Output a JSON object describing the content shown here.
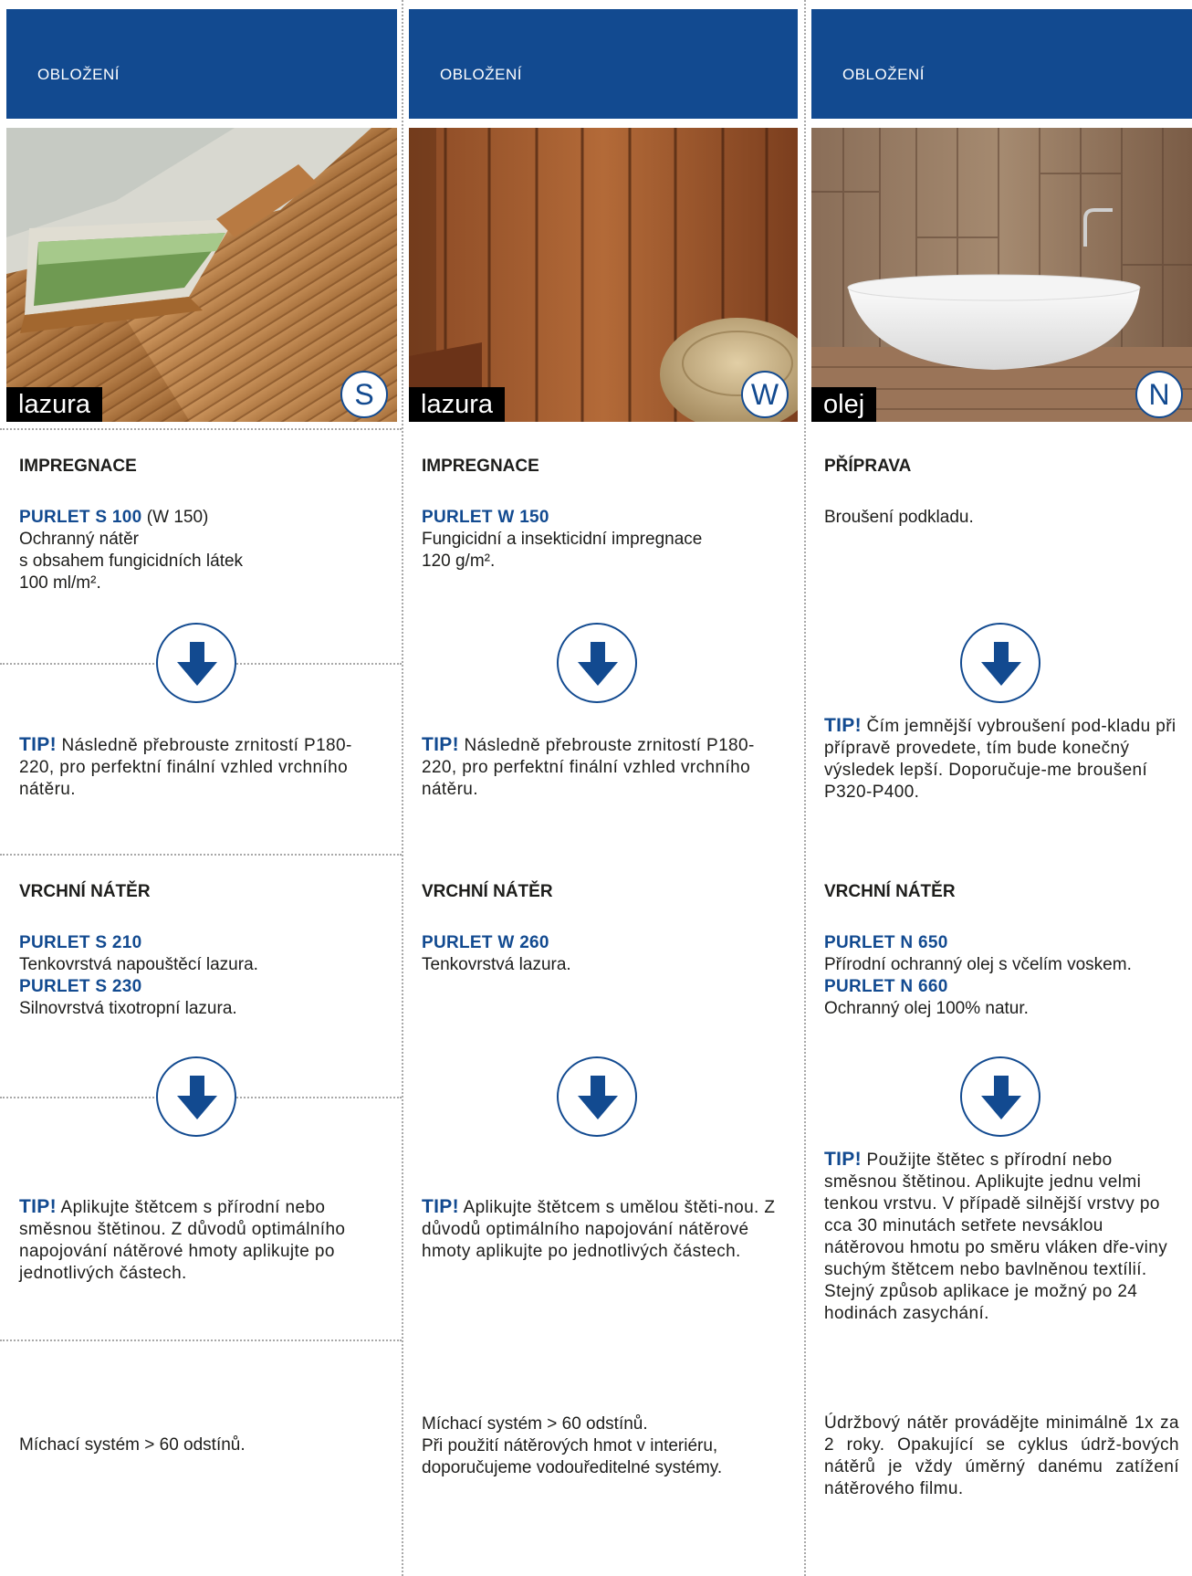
{
  "colors": {
    "brand_blue": "#124a90",
    "label_black": "#000000",
    "dotted_rule": "#a8a8a8"
  },
  "columns": [
    {
      "header": "OBLOŽENÍ",
      "photo_subject": "attic-skylight-wood-paneling",
      "finish": "lazura",
      "system": "S",
      "stage1": {
        "title": "IMPREGNACE",
        "product": "PURLET S 100",
        "product_suffix": " (W 150)",
        "lines": [
          "Ochranný nátěr",
          "s obsahem fungicidních látek",
          "100 ml/m²."
        ]
      },
      "tip1": {
        "label": "TIP!",
        "text": " Následně přebrouste zrnitostí P180-220, pro perfektní finální vzhled vrchního nátěru."
      },
      "stage2": {
        "title": "VRCHNÍ NÁTĚR",
        "product_a": "PURLET S 210",
        "desc_a": "Tenkovrstvá napouštěcí lazura.",
        "product_b": "PURLET S 230",
        "desc_b": "Silnovrstvá tixotropní lazura."
      },
      "tip2": {
        "label": "TIP!",
        "text": " Aplikujte štětcem s přírodní nebo směsnou štětinou. Z důvodů optimálního napojování nátěrové hmoty aplikujte po jednotlivých částech."
      },
      "footer": [
        "Míchací systém > 60 odstínů."
      ]
    },
    {
      "header": "OBLOŽENÍ",
      "photo_subject": "wood-wall-panels",
      "finish": "lazura",
      "system": "W",
      "stage1": {
        "title": "IMPREGNACE",
        "product": "PURLET W 150",
        "product_suffix": "",
        "lines": [
          "Fungicidní a insekticidní impregnace",
          "120 g/m²."
        ]
      },
      "tip1": {
        "label": "TIP!",
        "text": " Následně přebrouste zrnitostí P180-220, pro perfektní finální vzhled vrchního nátěru."
      },
      "stage2": {
        "title": "VRCHNÍ NÁTĚR",
        "product_a": "PURLET W 260",
        "desc_a": "Tenkovrstvá lazura.",
        "product_b": "",
        "desc_b": ""
      },
      "tip2": {
        "label": "TIP!",
        "text": " Aplikujte štětcem s umělou štěti-nou. Z důvodů optimálního napojování nátěrové hmoty aplikujte po jednotlivých částech."
      },
      "footer": [
        "Míchací systém > 60 odstínů.",
        "Při použití nátěrových hmot v interiéru, doporučujeme vodouředitelné systémy."
      ]
    },
    {
      "header": "OBLOŽENÍ",
      "photo_subject": "bathtub-wood-wall",
      "finish": "olej",
      "system": "N",
      "stage1": {
        "title": "PŘÍPRAVA",
        "product": "",
        "product_suffix": "",
        "lines": [
          "Broušení podkladu."
        ]
      },
      "tip1": {
        "label": "TIP!",
        "text": " Čím jemnější vybroušení pod-kladu při přípravě provedete, tím bude konečný výsledek lepší. Doporučuje-me broušení P320-P400."
      },
      "stage2": {
        "title": "VRCHNÍ NÁTĚR",
        "product_a": "PURLET N 650",
        "desc_a": "Přírodní ochranný olej s včelím voskem.",
        "product_b": "PURLET N 660",
        "desc_b": "Ochranný olej 100% natur."
      },
      "tip2": {
        "label": "TIP!",
        "text": " Použijte štětec s přírodní nebo směsnou štětinou. Aplikujte jednu velmi tenkou vrstvu. V případě silnější vrstvy po cca 30 minutách setřete nevsáklou nátěrovou hmotu po směru vláken dře-viny suchým štětcem nebo bavlněnou textílií. Stejný způsob aplikace je možný po 24 hodinách zasychání."
      },
      "footer": [
        "Údržbový nátěr provádějte minimálně 1x za 2 roky. Opakující se cyklus údrž-bových nátěrů je vždy úměrný danému zatížení nátěrového filmu."
      ]
    }
  ]
}
